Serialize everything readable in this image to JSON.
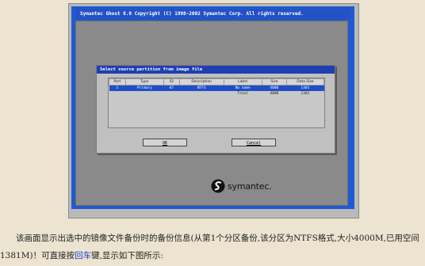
{
  "ghost_window": {
    "title": "Symantec Ghost 8.0   Copyright (C) 1998-2002 Symantec Corp. All rights reserved."
  },
  "dialog": {
    "title": "Select source partition from image file",
    "columns": [
      "Part",
      "Type",
      "ID",
      "Description",
      "Label",
      "Size",
      "Data Size"
    ],
    "rows": [
      {
        "part": "1",
        "type": "Primary",
        "id": "07",
        "description": "NTFS",
        "label": "No name",
        "size": "4000",
        "data_size": "1381"
      }
    ],
    "total": {
      "label": "Total",
      "size": "4000",
      "data_size": "1381"
    },
    "ok_label": "OK",
    "cancel_label": "Cancel"
  },
  "logo": {
    "text": "symantec."
  },
  "caption": {
    "line1": "该画面显示出选中的镜像文件备份时的备份信息(从第1个分区备份,该分区为NTFS格式,大小4000M,已用空间",
    "line2_prefix": "1381M)！可直接按",
    "line2_key": "回车",
    "line2_suffix": "键,显示如下图所示:"
  },
  "colors": {
    "ghost_blue": "#1d5bd1",
    "selection_blue": "#1f4ec8",
    "page_bg": "#ece4d0"
  }
}
